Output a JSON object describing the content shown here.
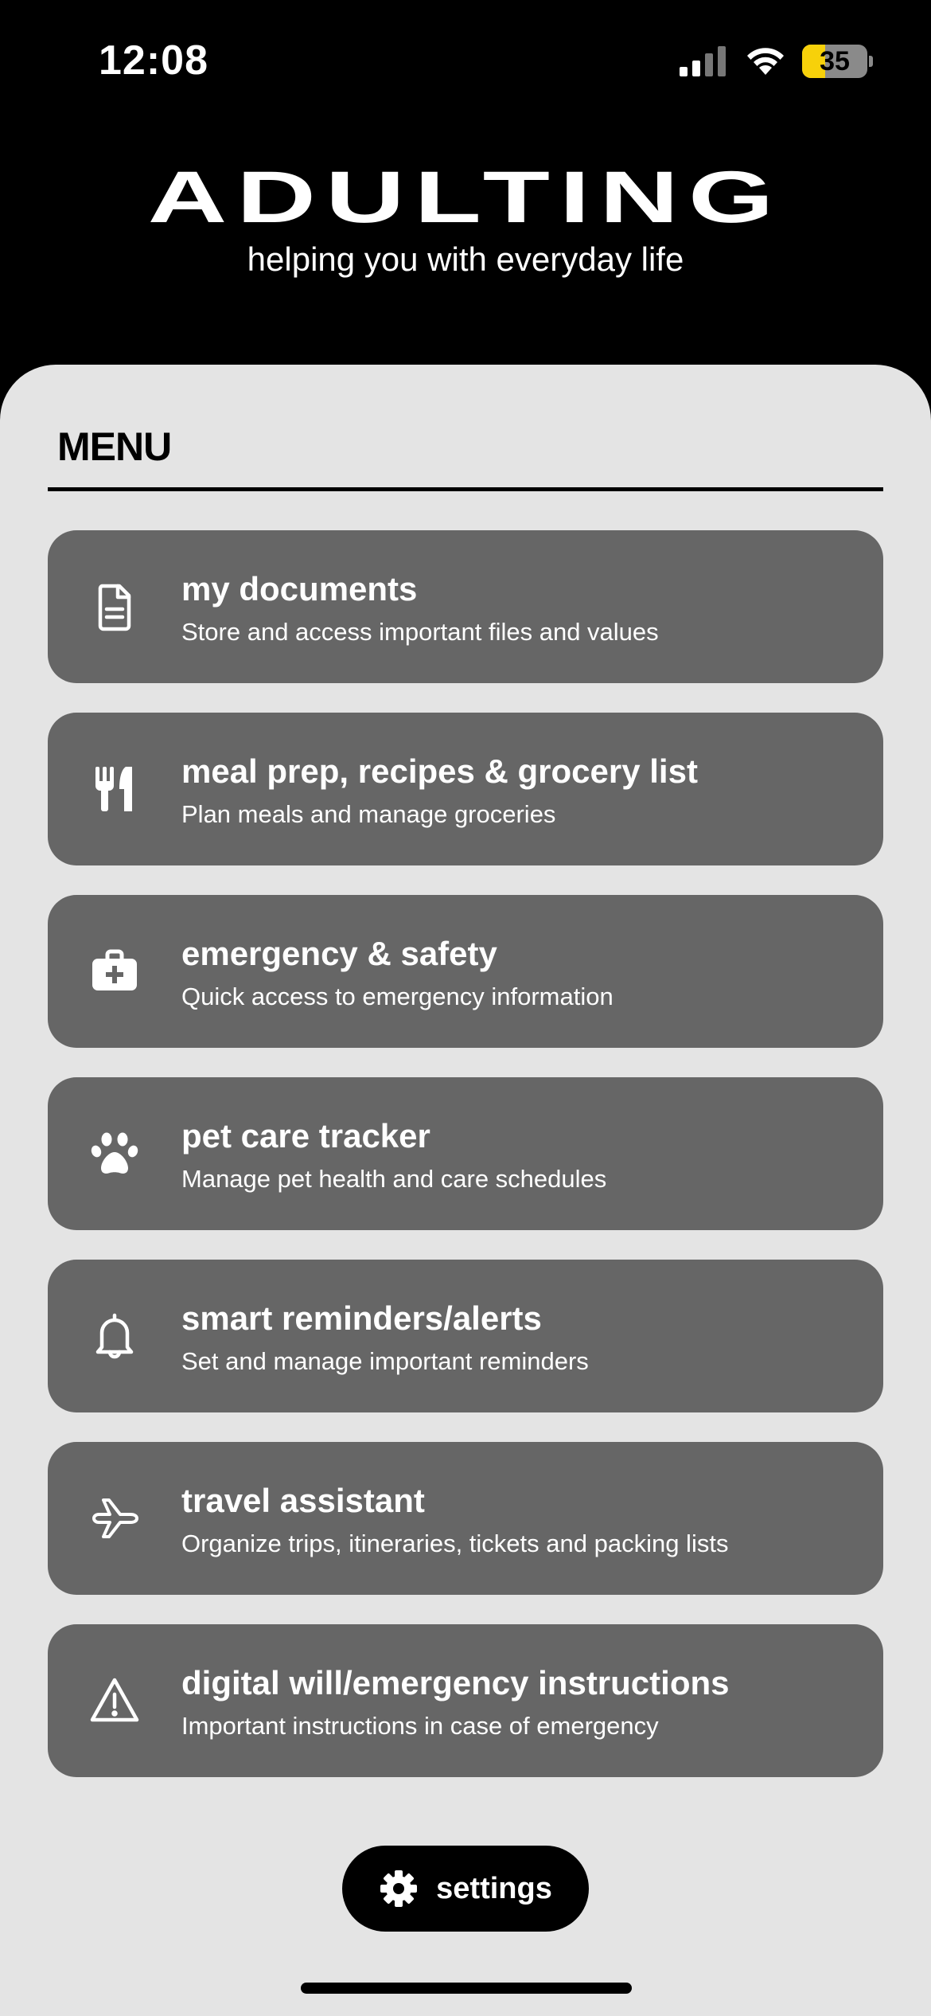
{
  "status_bar": {
    "time": "12:08",
    "battery_percent": "35",
    "battery_level": 0.35,
    "signal_bars_active": 2,
    "signal_bars_total": 4
  },
  "header": {
    "title": "ADULTING",
    "subtitle": "helping you with everyday life"
  },
  "menu": {
    "heading": "MENU",
    "items": [
      {
        "title": "my documents",
        "description": "Store and access important files and values",
        "icon": "document-icon"
      },
      {
        "title": "meal prep, recipes & grocery list",
        "description": "Plan meals and manage groceries",
        "icon": "fork-knife-icon"
      },
      {
        "title": "emergency & safety",
        "description": "Quick access to emergency information",
        "icon": "medical-kit-icon"
      },
      {
        "title": "pet care tracker",
        "description": "Manage pet health and care schedules",
        "icon": "paw-icon"
      },
      {
        "title": "smart reminders/alerts",
        "description": "Set and manage important reminders",
        "icon": "bell-icon"
      },
      {
        "title": "travel assistant",
        "description": "Organize trips, itineraries, tickets and packing lists",
        "icon": "airplane-icon"
      },
      {
        "title": "digital will/emergency instructions",
        "description": "Important instructions in case of emergency",
        "icon": "warning-icon"
      }
    ]
  },
  "settings": {
    "label": "settings",
    "icon": "gear-icon"
  },
  "colors": {
    "background": "#000000",
    "panel": "#e4e4e4",
    "card": "#666666",
    "battery_fill": "#f7d10a"
  }
}
